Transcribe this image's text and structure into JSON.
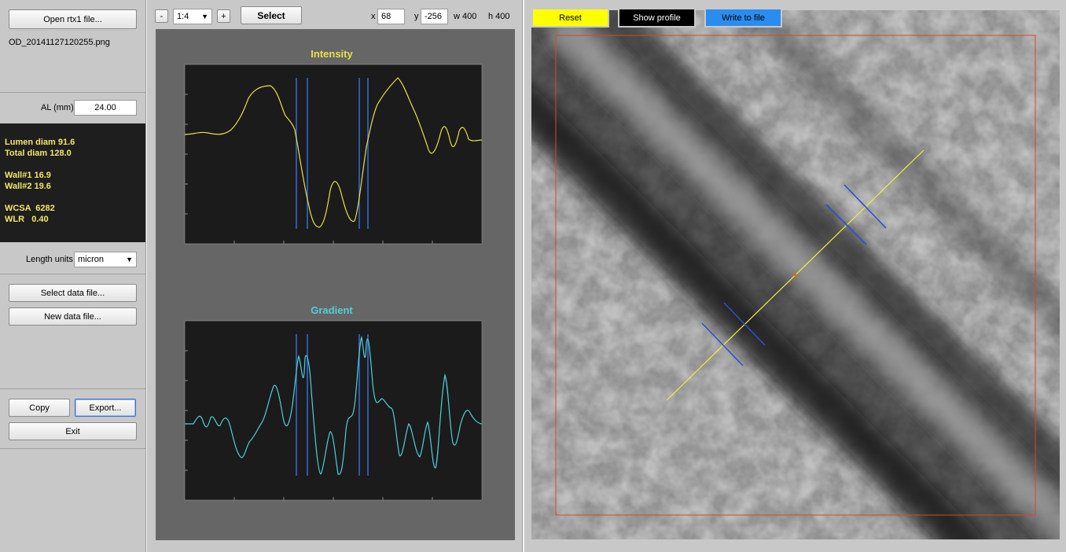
{
  "left_panel": {
    "open_button": "Open rtx1 file...",
    "filename": "OD_20141127120255.png",
    "al_label": "AL (mm)",
    "al_value": "24.00",
    "stats": {
      "lumen": "Lumen diam 91.6",
      "total": "Total diam 128.0",
      "wall1": "Wall#1 16.9",
      "wall2": "Wall#2 19.6",
      "wcsa": "WCSA  6282",
      "wlr": "WLR   0.40"
    },
    "length_units_label": "Length units",
    "length_units_value": "micron",
    "select_data_button": "Select data file...",
    "new_data_button": "New data file...",
    "copy_button": "Copy",
    "export_button": "Export...",
    "exit_button": "Exit"
  },
  "toolbar": {
    "zoom_out": "-",
    "zoom_value": "1:4",
    "zoom_in": "+",
    "select_button": "Select",
    "x_label": "x",
    "x_value": "68",
    "y_label": "y",
    "y_value": "-256",
    "w_text": "w 400",
    "h_text": "h 400"
  },
  "plots": {
    "intensity_title": "Intensity",
    "gradient_title": "Gradient",
    "intensity_color": "#e8e04a",
    "gradient_color": "#4fd0d8",
    "marker_color": "#3a6ad8"
  },
  "image_panel": {
    "reset_button": "Reset",
    "show_profile_button": "Show profile",
    "write_button": "Write to file",
    "reset_color": "#ffff00",
    "show_profile_color": "#000000",
    "write_color": "#2a8cf0"
  }
}
